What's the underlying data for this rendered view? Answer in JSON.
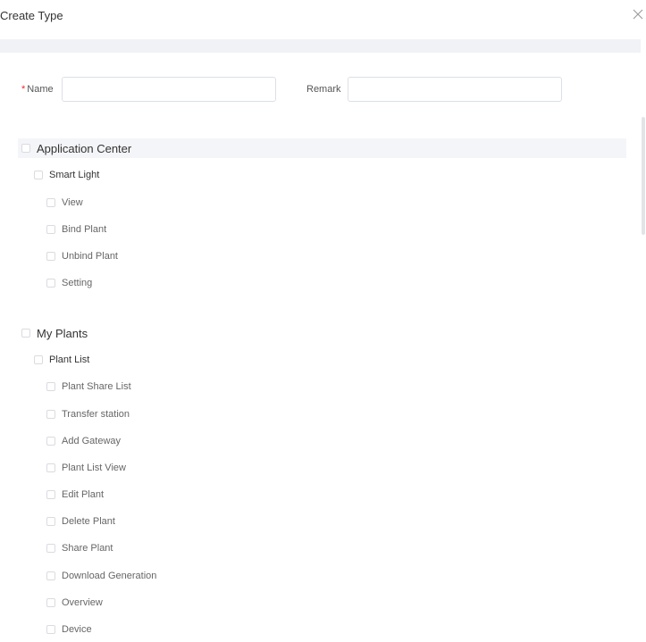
{
  "modal": {
    "title": "Create Type",
    "close_icon": "close-icon"
  },
  "form": {
    "name_required_mark": "*",
    "name_label": "Name",
    "name_value": "",
    "remark_label": "Remark",
    "remark_value": ""
  },
  "permissions": {
    "application_center": {
      "label": "Application Center",
      "checked": false,
      "groups": [
        {
          "label": "Smart Light",
          "checked": false,
          "items": [
            "View",
            "Bind Plant",
            "Unbind Plant",
            "Setting"
          ]
        }
      ]
    },
    "my_plants": {
      "label": "My Plants",
      "checked": false,
      "groups": [
        {
          "label": "Plant List",
          "checked": false,
          "items": [
            "Plant Share List",
            "Transfer station",
            "Add Gateway",
            "Plant List View",
            "Edit Plant",
            "Delete Plant",
            "Share Plant",
            "Download Generation",
            "Overview",
            "Device"
          ]
        }
      ]
    }
  },
  "colors": {
    "required": "#f5222d",
    "header_band": "#f1f2f5",
    "checkbox_border": "#d9dbe0"
  }
}
